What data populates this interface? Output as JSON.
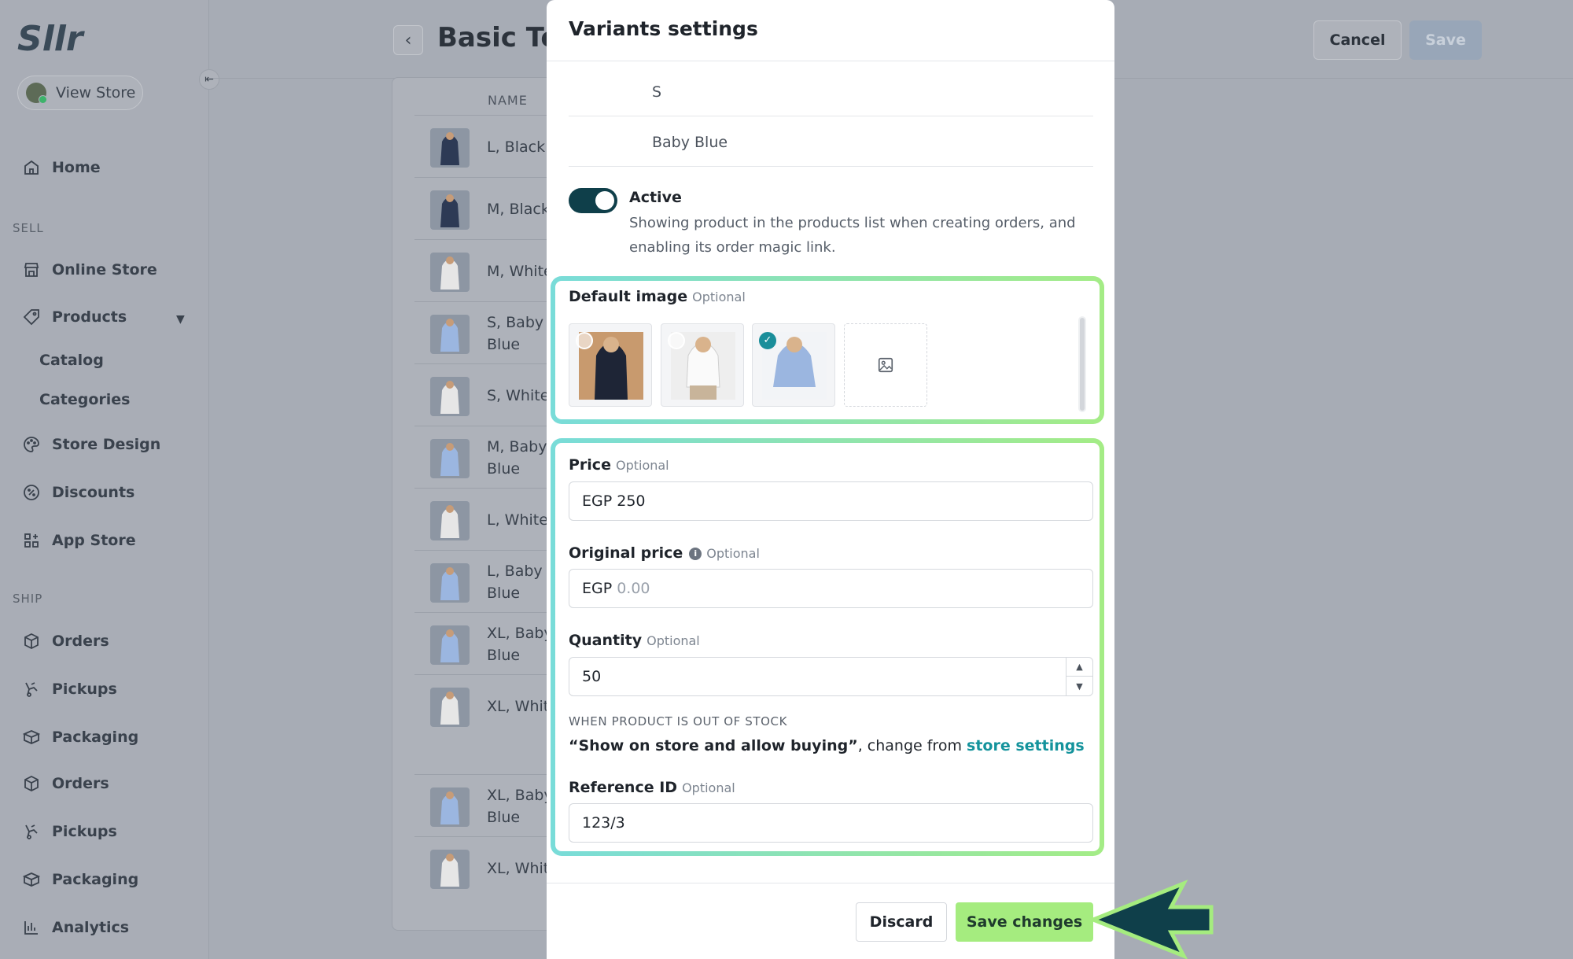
{
  "sidebar": {
    "view_store": "View Store",
    "items": [
      {
        "label": "Home",
        "icon": "home-icon"
      },
      {
        "label": "Online Store",
        "icon": "storefront-icon"
      },
      {
        "label": "Products",
        "icon": "tag-icon"
      },
      {
        "label": "Catalog"
      },
      {
        "label": "Categories"
      },
      {
        "label": "Store Design",
        "icon": "palette-icon"
      },
      {
        "label": "Discounts",
        "icon": "discount-icon"
      },
      {
        "label": "App Store",
        "icon": "apps-grid-icon"
      },
      {
        "label": "Orders",
        "icon": "box-icon"
      },
      {
        "label": "Pickups",
        "icon": "courier-icon"
      },
      {
        "label": "Packaging",
        "icon": "package-icon"
      },
      {
        "label": "Orders",
        "icon": "box-icon"
      },
      {
        "label": "Pickups",
        "icon": "courier-icon"
      },
      {
        "label": "Packaging",
        "icon": "package-icon"
      },
      {
        "label": "Analytics",
        "icon": "bar-chart-icon"
      }
    ],
    "sections": {
      "sell": "SELL",
      "ship": "SHIP"
    }
  },
  "page": {
    "title": "Basic Top",
    "cancel": "Cancel",
    "save": "Save",
    "table_header": "NAME",
    "rows": [
      "L, Black",
      "M, Black",
      "M, White",
      "S, Baby Blue",
      "S, White",
      "M, Baby Blue",
      "L, White",
      "L, Baby Blue",
      "XL, Baby Blue",
      "XL, White",
      "XL, Baby Blue",
      "XL, White"
    ]
  },
  "modal": {
    "title": "Variants settings",
    "options": [
      "S",
      "Baby Blue"
    ],
    "active": {
      "label": "Active",
      "on": true,
      "description": "Showing product in the products list when creating orders, and enabling its order magic link."
    },
    "default_image": {
      "label": "Default image",
      "optional": "Optional",
      "selected_index": 2
    },
    "price": {
      "label": "Price",
      "optional": "Optional",
      "value": "EGP 250"
    },
    "original_price": {
      "label": "Original price",
      "optional": "Optional",
      "prefix": "EGP",
      "placeholder": "0.00"
    },
    "quantity": {
      "label": "Quantity",
      "optional": "Optional",
      "value": "50"
    },
    "out_of_stock": {
      "title": "WHEN PRODUCT IS OUT OF STOCK",
      "setting": "“Show on store and allow buying”",
      "middle": ", change from ",
      "link": "store settings"
    },
    "reference_id": {
      "label": "Reference ID",
      "optional": "Optional",
      "value": "123/3"
    },
    "footer": {
      "discard": "Discard",
      "save": "Save changes"
    }
  },
  "colors": {
    "accent_dark": "#0f3f4a",
    "link": "#14939c",
    "save_green": "#a5ec7f",
    "highlight_start": "#79dcd9",
    "highlight_end": "#a4ec86"
  }
}
